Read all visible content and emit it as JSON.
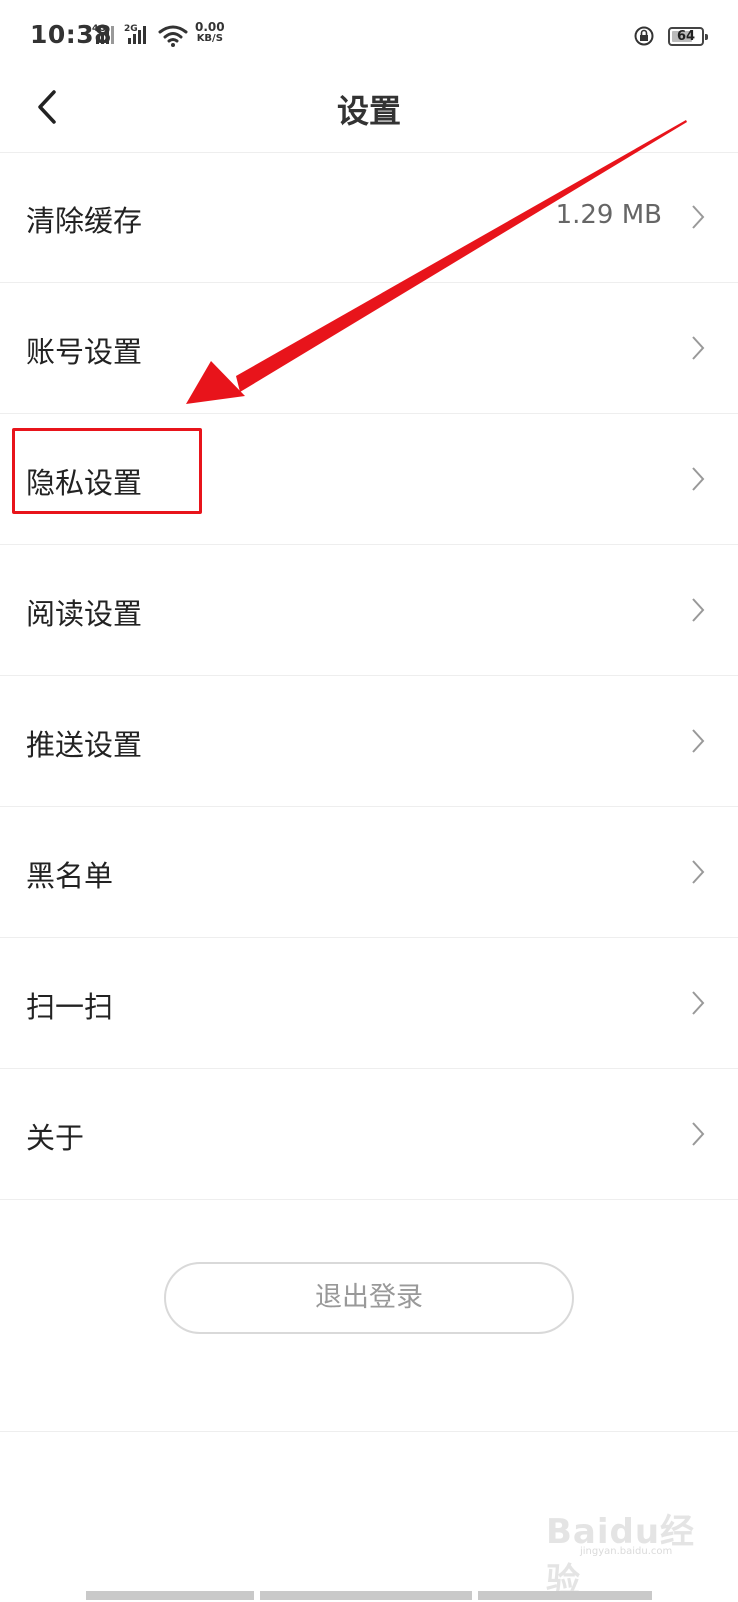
{
  "status_bar": {
    "time": "10:38",
    "sim1_label": "4G",
    "sim2_label": "2G",
    "net_speed_value": "0.00",
    "net_speed_unit": "KB/S",
    "battery": "64"
  },
  "header": {
    "title": "设置",
    "back_icon": "chevron-left-icon"
  },
  "menu": [
    {
      "label": "清除缓存",
      "value": "1.29 MB"
    },
    {
      "label": "账号设置",
      "value": ""
    },
    {
      "label": "隐私设置",
      "value": ""
    },
    {
      "label": "阅读设置",
      "value": ""
    },
    {
      "label": "推送设置",
      "value": ""
    },
    {
      "label": "黑名单",
      "value": ""
    },
    {
      "label": "扫一扫",
      "value": ""
    },
    {
      "label": "关于",
      "value": ""
    }
  ],
  "logout_label": "退出登录",
  "annotation": {
    "color": "#e8141b",
    "highlighted_item": "隐私设置"
  },
  "watermark": {
    "main": "Baidu经验",
    "sub": "jingyan.baidu.com"
  }
}
